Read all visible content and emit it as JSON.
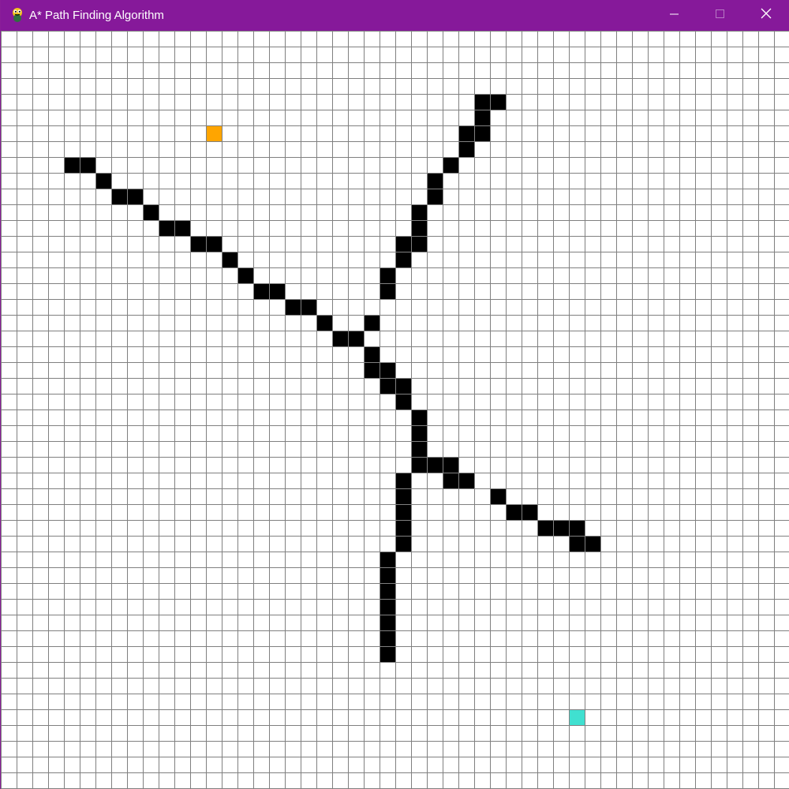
{
  "window": {
    "title": "A* Path Finding Algorithm",
    "titlebar_color": "#86199a",
    "icons": {
      "app": "python-snake-icon",
      "minimize": "minimize-icon",
      "maximize": "maximize-icon",
      "close": "close-icon"
    }
  },
  "grid": {
    "rows": 50,
    "cols": 50,
    "colors": {
      "empty": "#ffffff",
      "line": "#808080",
      "barrier": "#000000",
      "start": "#ffa500",
      "end": "#40e0d0"
    },
    "start": {
      "col": 13,
      "row": 6
    },
    "end": {
      "col": 36,
      "row": 43
    },
    "barriers": [
      [
        30,
        4
      ],
      [
        31,
        4
      ],
      [
        30,
        5
      ],
      [
        29,
        6
      ],
      [
        30,
        6
      ],
      [
        29,
        7
      ],
      [
        28,
        8
      ],
      [
        27,
        9
      ],
      [
        27,
        10
      ],
      [
        26,
        11
      ],
      [
        26,
        12
      ],
      [
        25,
        13
      ],
      [
        26,
        13
      ],
      [
        25,
        14
      ],
      [
        24,
        15
      ],
      [
        24,
        16
      ],
      [
        23,
        18
      ],
      [
        4,
        8
      ],
      [
        5,
        8
      ],
      [
        6,
        9
      ],
      [
        7,
        10
      ],
      [
        8,
        10
      ],
      [
        9,
        11
      ],
      [
        10,
        12
      ],
      [
        11,
        12
      ],
      [
        12,
        13
      ],
      [
        13,
        13
      ],
      [
        14,
        14
      ],
      [
        15,
        15
      ],
      [
        16,
        16
      ],
      [
        17,
        16
      ],
      [
        18,
        17
      ],
      [
        19,
        17
      ],
      [
        20,
        18
      ],
      [
        21,
        19
      ],
      [
        22,
        19
      ],
      [
        23,
        20
      ],
      [
        23,
        21
      ],
      [
        24,
        21
      ],
      [
        24,
        22
      ],
      [
        25,
        22
      ],
      [
        25,
        23
      ],
      [
        26,
        24
      ],
      [
        26,
        25
      ],
      [
        26,
        26
      ],
      [
        26,
        27
      ],
      [
        27,
        27
      ],
      [
        28,
        27
      ],
      [
        28,
        28
      ],
      [
        29,
        28
      ],
      [
        25,
        28
      ],
      [
        25,
        29
      ],
      [
        25,
        30
      ],
      [
        25,
        31
      ],
      [
        25,
        32
      ],
      [
        31,
        29
      ],
      [
        32,
        30
      ],
      [
        33,
        30
      ],
      [
        34,
        31
      ],
      [
        35,
        31
      ],
      [
        36,
        31
      ],
      [
        36,
        32
      ],
      [
        37,
        32
      ],
      [
        24,
        33
      ],
      [
        24,
        34
      ],
      [
        24,
        35
      ],
      [
        24,
        36
      ],
      [
        24,
        37
      ],
      [
        24,
        38
      ],
      [
        24,
        39
      ]
    ]
  }
}
